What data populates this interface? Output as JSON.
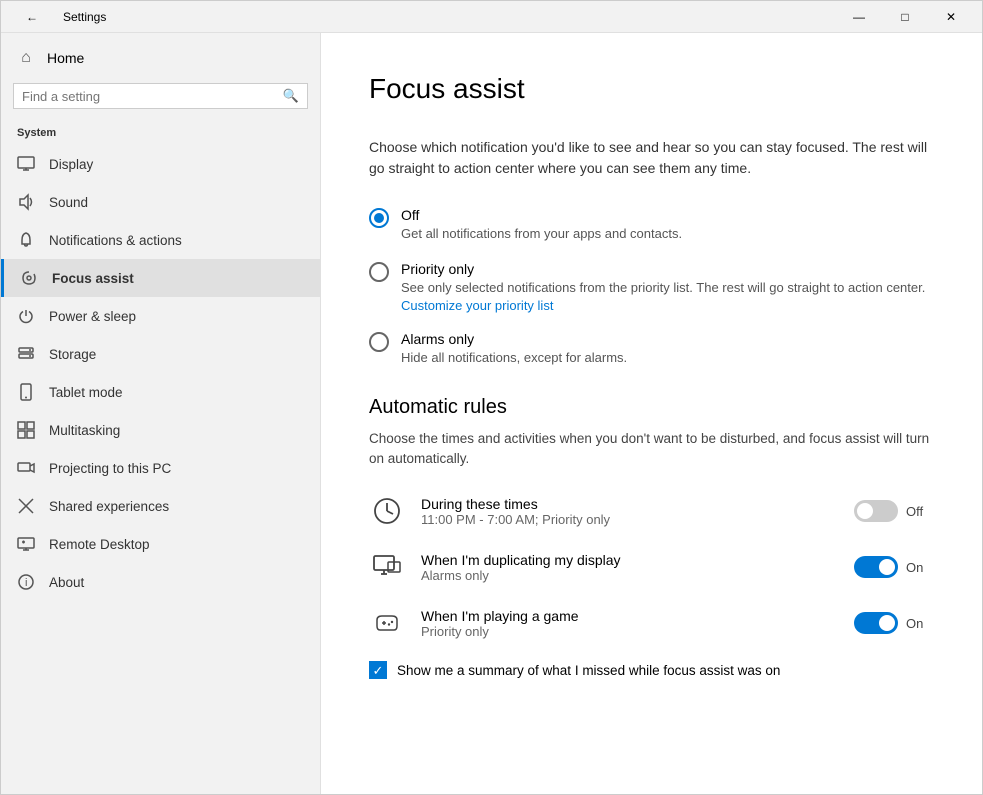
{
  "titlebar": {
    "back_icon": "←",
    "title": "Settings",
    "minimize": "—",
    "maximize": "□",
    "close": "✕"
  },
  "sidebar": {
    "home_label": "Home",
    "search_placeholder": "Find a setting",
    "section_header": "System",
    "items": [
      {
        "id": "display",
        "label": "Display",
        "icon": "🖥"
      },
      {
        "id": "sound",
        "label": "Sound",
        "icon": "🔊"
      },
      {
        "id": "notifications",
        "label": "Notifications & actions",
        "icon": "💬"
      },
      {
        "id": "focus",
        "label": "Focus assist",
        "icon": "🌙",
        "active": true
      },
      {
        "id": "power",
        "label": "Power & sleep",
        "icon": "⏻"
      },
      {
        "id": "storage",
        "label": "Storage",
        "icon": "🗄"
      },
      {
        "id": "tablet",
        "label": "Tablet mode",
        "icon": "📱"
      },
      {
        "id": "multitasking",
        "label": "Multitasking",
        "icon": "⊞"
      },
      {
        "id": "projecting",
        "label": "Projecting to this PC",
        "icon": "📡"
      },
      {
        "id": "shared",
        "label": "Shared experiences",
        "icon": "✖"
      },
      {
        "id": "remote",
        "label": "Remote Desktop",
        "icon": "🖥"
      },
      {
        "id": "about",
        "label": "About",
        "icon": "ℹ"
      }
    ]
  },
  "main": {
    "page_title": "Focus assist",
    "description": "Choose which notification you'd like to see and hear so you can stay focused. The rest will go straight to action center where you can see them any time.",
    "radio_options": [
      {
        "id": "off",
        "label": "Off",
        "sublabel": "Get all notifications from your apps and contacts.",
        "selected": true,
        "link": null
      },
      {
        "id": "priority",
        "label": "Priority only",
        "sublabel": "See only selected notifications from the priority list. The rest will go straight to action center.",
        "selected": false,
        "link": "Customize your priority list"
      },
      {
        "id": "alarms",
        "label": "Alarms only",
        "sublabel": "Hide all notifications, except for alarms.",
        "selected": false,
        "link": null
      }
    ],
    "automatic_rules_title": "Automatic rules",
    "automatic_rules_desc": "Choose the times and activities when you don't want to be disturbed, and focus assist will turn on automatically.",
    "rules": [
      {
        "id": "during_times",
        "icon": "clock",
        "label": "During these times",
        "sublabel": "11:00 PM - 7:00 AM; Priority only",
        "toggle": "off",
        "toggle_label": "Off"
      },
      {
        "id": "duplicating",
        "icon": "monitor",
        "label": "When I'm duplicating my display",
        "sublabel": "Alarms only",
        "toggle": "on",
        "toggle_label": "On"
      },
      {
        "id": "game",
        "icon": "gamepad",
        "label": "When I'm playing a game",
        "sublabel": "Priority only",
        "toggle": "on",
        "toggle_label": "On"
      }
    ],
    "checkbox_label": "Show me a summary of what I missed while focus assist was on",
    "checkbox_checked": true
  }
}
